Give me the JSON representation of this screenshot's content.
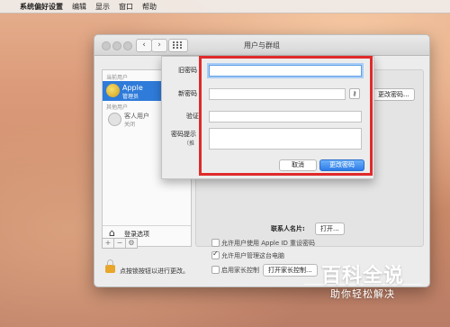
{
  "menubar": {
    "apple_icon": "apple-icon",
    "items": [
      "系统偏好设置",
      "编辑",
      "显示",
      "窗口",
      "帮助"
    ]
  },
  "window": {
    "title": "用户与群组",
    "sidebar": {
      "current_users_header": "当前用户",
      "current_user": {
        "name": "Apple",
        "role": "管理员"
      },
      "other_users_header": "其他用户",
      "guest_user": {
        "name": "客人用户",
        "status": "关闭"
      },
      "login_options": "登录选项",
      "tools": [
        "+",
        "−",
        "⚙"
      ]
    },
    "pane": {
      "change_password_button": "更改密码...",
      "contact_card_label": "联系人名片:",
      "open_button": "打开...",
      "options": [
        {
          "label": "允许用户使用 Apple ID 重设密码",
          "checked": false
        },
        {
          "label": "允许用户管理这台电脑",
          "checked": true
        },
        {
          "label": "启用家长控制",
          "checked": false
        }
      ],
      "parental_controls_button": "打开家长控制..."
    },
    "lock_text": "点按锁按钮以进行更改。"
  },
  "sheet": {
    "old_password_label": "旧密码",
    "new_password_label": "新密码",
    "verify_label": "验证",
    "hint_label": "密码提示",
    "hint_sub_label": "（推",
    "old_password_value": "",
    "new_password_value": "",
    "verify_value": "",
    "hint_value": "",
    "key_icon": "key-icon",
    "cancel_button": "取消",
    "change_button": "更改密码",
    "highlight_color": "#e02a2a",
    "accent_color": "#2e7ce8"
  },
  "watermark": {
    "line1": "百科全说",
    "line2": "助你轻松解决"
  }
}
